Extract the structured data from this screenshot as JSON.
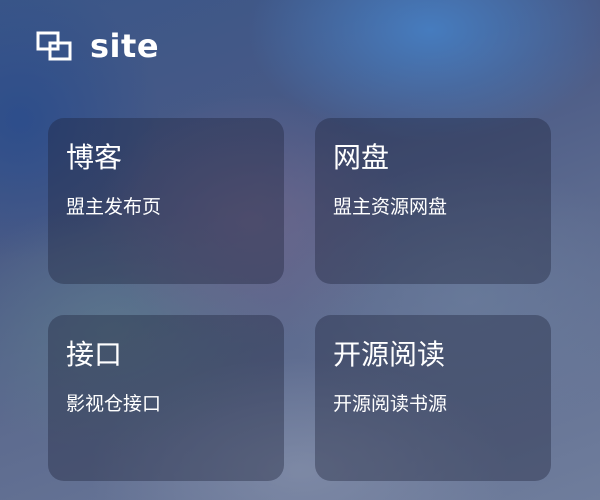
{
  "header": {
    "icon": "overlapping-squares-icon",
    "title": "site"
  },
  "cards": [
    {
      "title": "博客",
      "subtitle": "盟主发布页"
    },
    {
      "title": "网盘",
      "subtitle": "盟主资源网盘"
    },
    {
      "title": "接口",
      "subtitle": "影视仓接口"
    },
    {
      "title": "开源阅读",
      "subtitle": "开源阅读书源"
    }
  ],
  "colors": {
    "text": "#ffffff",
    "card_background": "rgba(28,34,58,0.38)",
    "background_top": "#3a5688",
    "background_bottom": "#6f7d9c"
  }
}
